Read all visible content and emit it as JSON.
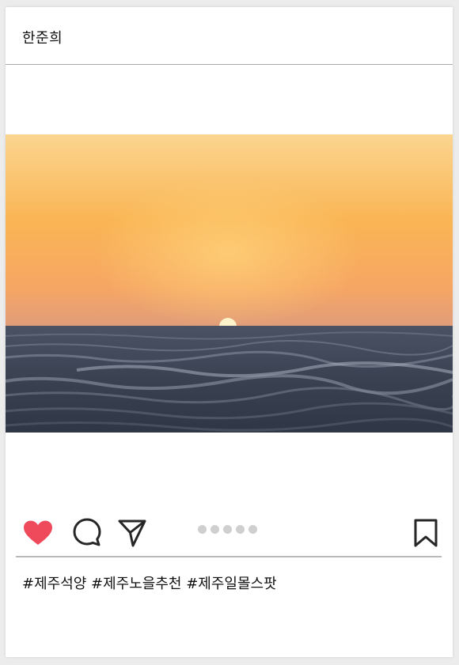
{
  "post": {
    "username": "한준희",
    "caption": "#제주석양 #제주노을추천 #제주일몰스팟"
  },
  "photo": {
    "subject": "sunset over the sea",
    "sky_top_color": "#fbd28e",
    "sky_mid_color": "#f9b255",
    "sky_horizon_color": "#e9a173",
    "sun_color": "#fff2c8",
    "sea_color": "#3d4556"
  },
  "actions": {
    "like_icon": "heart-icon",
    "liked": true,
    "like_color": "#ef4a5c",
    "comment_icon": "comment-icon",
    "share_icon": "share-icon",
    "bookmark_icon": "bookmark-icon"
  },
  "carousel": {
    "total": 5,
    "active": 1
  }
}
